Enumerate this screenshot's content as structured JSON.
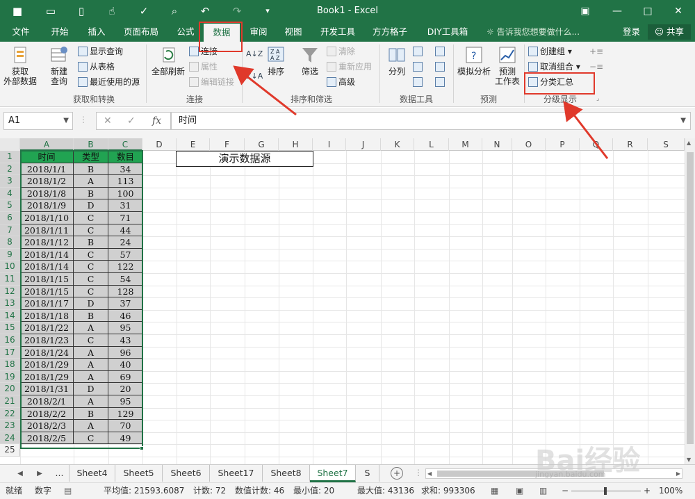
{
  "titlebar": {
    "title": "Book1 - Excel",
    "quick_access": [
      "save-icon",
      "open-icon",
      "new-icon",
      "touch-icon",
      "spell-icon",
      "preview-icon",
      "undo-icon",
      "redo-icon",
      "customize-icon"
    ]
  },
  "tabs": [
    {
      "label": "文件"
    },
    {
      "label": "开始"
    },
    {
      "label": "插入"
    },
    {
      "label": "页面布局"
    },
    {
      "label": "公式"
    },
    {
      "label": "数据"
    },
    {
      "label": "审阅"
    },
    {
      "label": "视图"
    },
    {
      "label": "开发工具"
    },
    {
      "label": "方方格子"
    },
    {
      "label": "DIY工具箱"
    }
  ],
  "tell_me": "告诉我您想要做什么...",
  "login": "登录",
  "share": "共享",
  "ribbon": {
    "get_external": "获取\n外部数据",
    "new_query": "新建\n查询",
    "show_query": "显示查询",
    "from_table": "从表格",
    "recent_sources": "最近使用的源",
    "group_get_transform": "获取和转换",
    "refresh_all": "全部刷新",
    "connections": "连接",
    "properties": "属性",
    "edit_links": "编辑链接",
    "group_connections": "连接",
    "sort": "排序",
    "filter": "筛选",
    "clear": "清除",
    "reapply": "重新应用",
    "advanced": "高级",
    "group_sort_filter": "排序和筛选",
    "split_col": "分列",
    "group_data_tools": "数据工具",
    "whatif": "模拟分析",
    "forecast": "预测\n工作表",
    "group_forecast": "预测",
    "create_group": "创建组",
    "ungroup": "取消组合",
    "subtotal": "分类汇总",
    "group_outline": "分级显示"
  },
  "formula_bar": {
    "namebox": "A1",
    "fx": "fx",
    "content": "时间"
  },
  "columns": [
    "A",
    "B",
    "C",
    "D",
    "E",
    "F",
    "G",
    "H",
    "I",
    "J",
    "K",
    "L",
    "M",
    "N",
    "O",
    "P",
    "Q",
    "R",
    "S"
  ],
  "rows": [
    "1",
    "2",
    "3",
    "4",
    "5",
    "6",
    "7",
    "8",
    "9",
    "10",
    "11",
    "12",
    "13",
    "14",
    "15",
    "16",
    "17",
    "18",
    "19",
    "20",
    "21",
    "22",
    "23",
    "24",
    "25"
  ],
  "table": {
    "headers": [
      "时间",
      "类型",
      "数目"
    ],
    "rows": [
      [
        "2018/1/1",
        "B",
        "34"
      ],
      [
        "2018/1/2",
        "A",
        "113"
      ],
      [
        "2018/1/8",
        "B",
        "100"
      ],
      [
        "2018/1/9",
        "D",
        "31"
      ],
      [
        "2018/1/10",
        "C",
        "71"
      ],
      [
        "2018/1/11",
        "C",
        "44"
      ],
      [
        "2018/1/12",
        "B",
        "24"
      ],
      [
        "2018/1/14",
        "C",
        "57"
      ],
      [
        "2018/1/14",
        "C",
        "122"
      ],
      [
        "2018/1/15",
        "C",
        "54"
      ],
      [
        "2018/1/15",
        "C",
        "128"
      ],
      [
        "2018/1/17",
        "D",
        "37"
      ],
      [
        "2018/1/18",
        "B",
        "46"
      ],
      [
        "2018/1/22",
        "A",
        "95"
      ],
      [
        "2018/1/23",
        "C",
        "43"
      ],
      [
        "2018/1/24",
        "A",
        "96"
      ],
      [
        "2018/1/29",
        "A",
        "40"
      ],
      [
        "2018/1/29",
        "A",
        "69"
      ],
      [
        "2018/1/31",
        "D",
        "20"
      ],
      [
        "2018/2/1",
        "A",
        "95"
      ],
      [
        "2018/2/2",
        "B",
        "129"
      ],
      [
        "2018/2/3",
        "A",
        "70"
      ],
      [
        "2018/2/5",
        "C",
        "49"
      ]
    ]
  },
  "demo_label": "演示数据源",
  "sheets": [
    {
      "label": "..."
    },
    {
      "label": "Sheet4"
    },
    {
      "label": "Sheet5"
    },
    {
      "label": "Sheet6"
    },
    {
      "label": "Sheet17"
    },
    {
      "label": "Sheet8"
    },
    {
      "label": "Sheet7"
    },
    {
      "label": "S"
    }
  ],
  "active_sheet": "Sheet7",
  "status": {
    "ready": "就绪",
    "num": "数字",
    "average": "平均值: 21593.6087",
    "count": "计数: 72",
    "numeric_count": "数值计数: 46",
    "min": "最小值: 20",
    "max": "最大值: 43136",
    "sum": "求和: 993306",
    "zoom": "100%"
  },
  "watermark": "Bai经验",
  "watermark_url": "jingyan.baidu.com",
  "colors": {
    "excel_green": "#217346",
    "header_fill": "#21a352",
    "data_fill": "#d0d0d0",
    "annotation_red": "#e0392b"
  }
}
